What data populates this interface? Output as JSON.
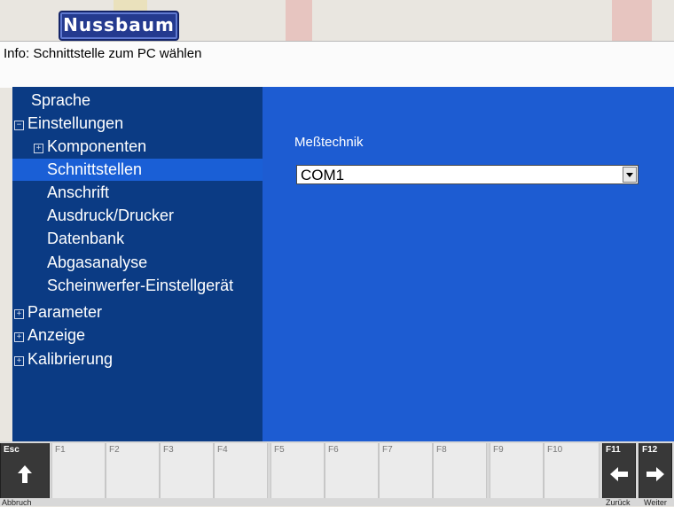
{
  "header": {
    "logo_text": "Nussbaum",
    "info_text": "Info: Schnittstelle zum PC wählen"
  },
  "sidebar": {
    "items": [
      {
        "label": "Sprache",
        "level": 0,
        "toggle": "",
        "selected": false
      },
      {
        "label": "Einstellungen",
        "level": 0,
        "toggle": "⊟",
        "selected": false
      },
      {
        "label": "Komponenten",
        "level": 1,
        "toggle": "⊞",
        "selected": false
      },
      {
        "label": "Schnittstellen",
        "level": 1,
        "toggle": "",
        "selected": true
      },
      {
        "label": "Anschrift",
        "level": 1,
        "toggle": "",
        "selected": false
      },
      {
        "label": "Ausdruck/Drucker",
        "level": 1,
        "toggle": "",
        "selected": false
      },
      {
        "label": "Datenbank",
        "level": 1,
        "toggle": "",
        "selected": false
      },
      {
        "label": "Abgasanalyse",
        "level": 1,
        "toggle": "",
        "selected": false
      },
      {
        "label": "Scheinwerfer-Einstellgerät",
        "level": 1,
        "toggle": "",
        "selected": false
      },
      {
        "label": "Parameter",
        "level": 0,
        "toggle": "⊞",
        "selected": false
      },
      {
        "label": "Anzeige",
        "level": 0,
        "toggle": "⊞",
        "selected": false
      },
      {
        "label": "Kalibrierung",
        "level": 0,
        "toggle": "⊞",
        "selected": false
      }
    ]
  },
  "main": {
    "field_label": "Meßtechnik",
    "select_value": "COM1"
  },
  "fkeys": {
    "esc": {
      "label": "Esc",
      "caption": "Abbruch",
      "icon": "arrow-up-icon"
    },
    "f1": {
      "label": "F1"
    },
    "f2": {
      "label": "F2"
    },
    "f3": {
      "label": "F3"
    },
    "f4": {
      "label": "F4"
    },
    "f5": {
      "label": "F5"
    },
    "f6": {
      "label": "F6"
    },
    "f7": {
      "label": "F7"
    },
    "f8": {
      "label": "F8"
    },
    "f9": {
      "label": "F9"
    },
    "f10": {
      "label": "F10"
    },
    "f11": {
      "label": "F11",
      "caption": "Zurück",
      "icon": "arrow-left-icon"
    },
    "f12": {
      "label": "F12",
      "caption": "Weiter",
      "icon": "arrow-right-icon"
    }
  },
  "colors": {
    "sidebar_bg": "#0b3b84",
    "selected_bg": "#1a5fd6",
    "panel_bg": "#1d5cd2",
    "logo_bg": "#243a8f"
  }
}
